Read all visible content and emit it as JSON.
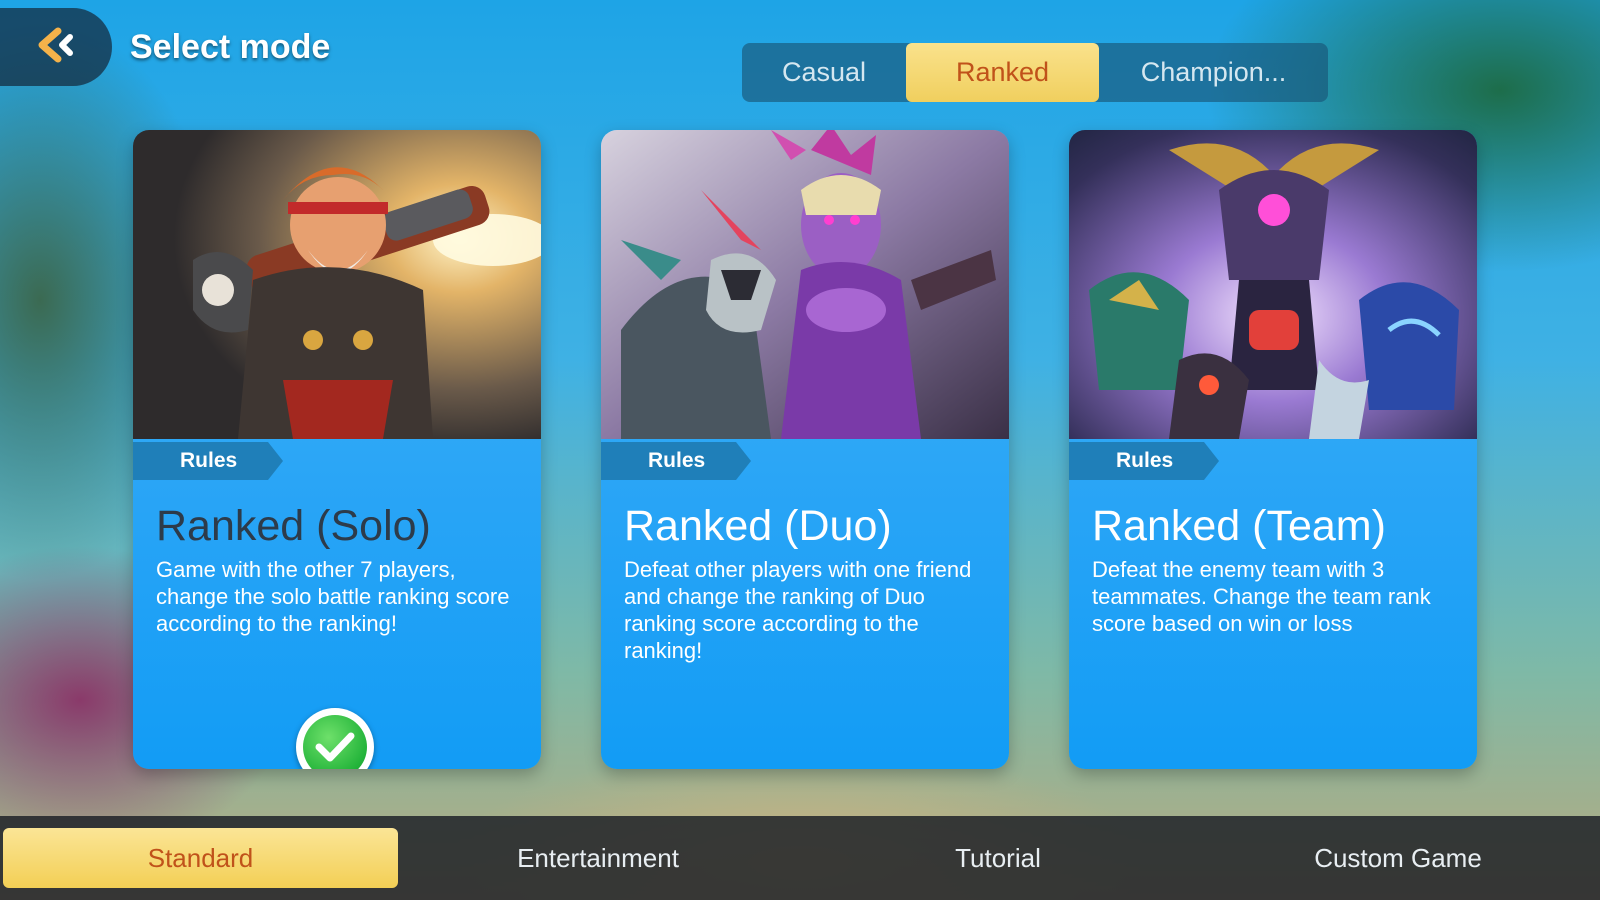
{
  "header": {
    "back_icon": "back-arrow-icon",
    "title": "Select mode"
  },
  "mode_tabs": [
    {
      "label": "Casual",
      "active": false
    },
    {
      "label": "Ranked",
      "active": true
    },
    {
      "label": "Champion...",
      "active": false
    }
  ],
  "cards": [
    {
      "rules_label": "Rules",
      "title": "Ranked (Solo)",
      "description": "Game with the other 7 players, change the solo battle ranking score according to the ranking!",
      "selected": true
    },
    {
      "rules_label": "Rules",
      "title": "Ranked (Duo)",
      "description": "Defeat other players with one friend and change the ranking of Duo ranking score according to the ranking!",
      "selected": false
    },
    {
      "rules_label": "Rules",
      "title": "Ranked (Team)",
      "description": "Defeat the enemy team with 3 teammates. Change the team rank score based on win or loss",
      "selected": false
    }
  ],
  "bottom_tabs": [
    {
      "label": "Standard",
      "active": true
    },
    {
      "label": "Entertainment",
      "active": false
    },
    {
      "label": "Tutorial",
      "active": false
    },
    {
      "label": "Custom Game",
      "active": false
    }
  ],
  "colors": {
    "accent_gold": "#f0cf5e",
    "active_text": "#c0521a",
    "card_blue": "#2aa5f6",
    "rules_tag": "#1f7fb9",
    "check_green": "#23b43a"
  }
}
